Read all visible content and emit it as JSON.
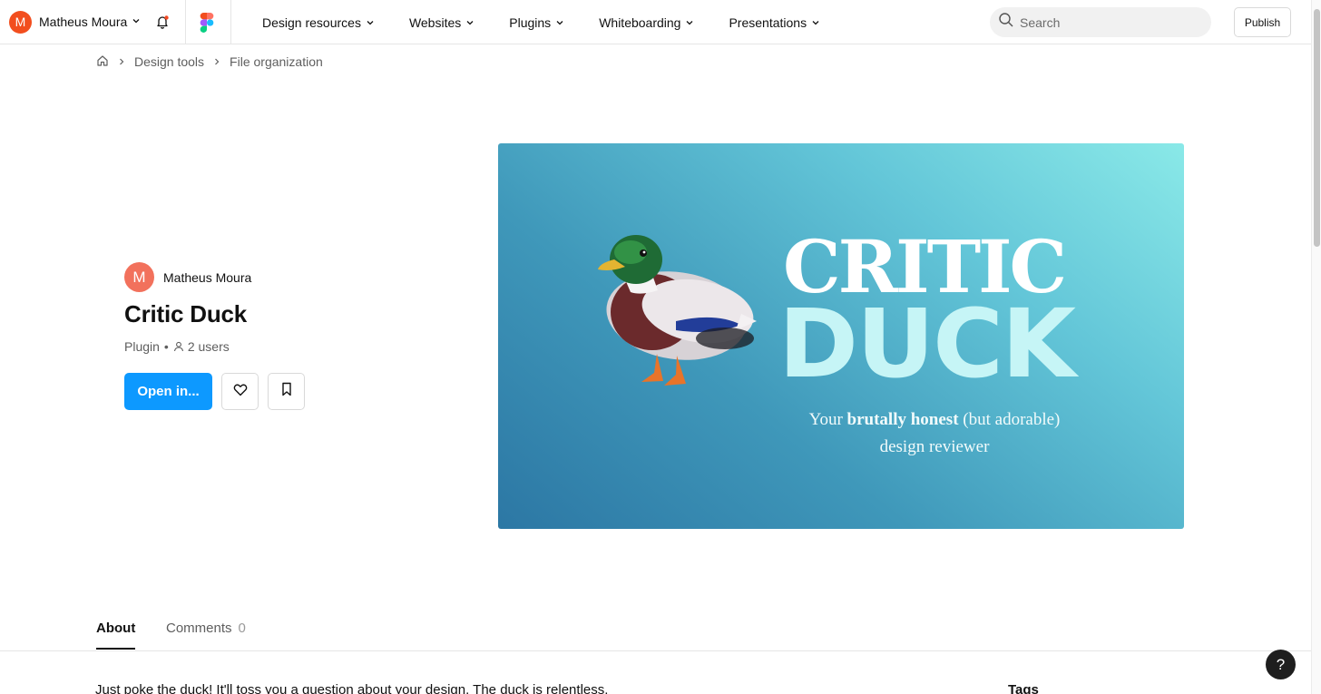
{
  "topbar": {
    "account": {
      "initial": "M",
      "name": "Matheus Moura",
      "avatar_color": "#f24e1e"
    },
    "icons": [
      "chevron-down-icon",
      "bell-icon",
      "figma-logo"
    ],
    "nav": [
      {
        "label": "Design resources"
      },
      {
        "label": "Websites"
      },
      {
        "label": "Plugins"
      },
      {
        "label": "Whiteboarding"
      },
      {
        "label": "Presentations"
      }
    ],
    "search": {
      "placeholder": "Search",
      "value": ""
    },
    "publish_label": "Publish"
  },
  "breadcrumb": {
    "home_icon": "home-icon",
    "items": [
      {
        "label": "Design tools"
      },
      {
        "label": "File organization"
      }
    ]
  },
  "resource": {
    "author": {
      "initial": "M",
      "name": "Matheus Moura",
      "avatar_color": "#f2715c"
    },
    "title": "Critic Duck",
    "type": "Plugin",
    "separator": "•",
    "users": "2 users",
    "open_label": "Open in...",
    "like_icon": "heart-icon",
    "save_icon": "bookmark-icon",
    "accent": "#0d99ff"
  },
  "hero": {
    "line1": "CRITIC",
    "line2": "DUCK",
    "tagline_before": "Your ",
    "tagline_bold": "brutally honest",
    "tagline_after": " (but adorable)",
    "tagline_line2": "design reviewer"
  },
  "tabs": [
    {
      "label": "About",
      "active": true
    },
    {
      "label": "Comments",
      "count": "0",
      "active": false
    }
  ],
  "about": {
    "description": "Just poke the duck! It'll toss you a question about your design. The duck is relentless.",
    "tags_heading": "Tags"
  },
  "help_label": "?"
}
